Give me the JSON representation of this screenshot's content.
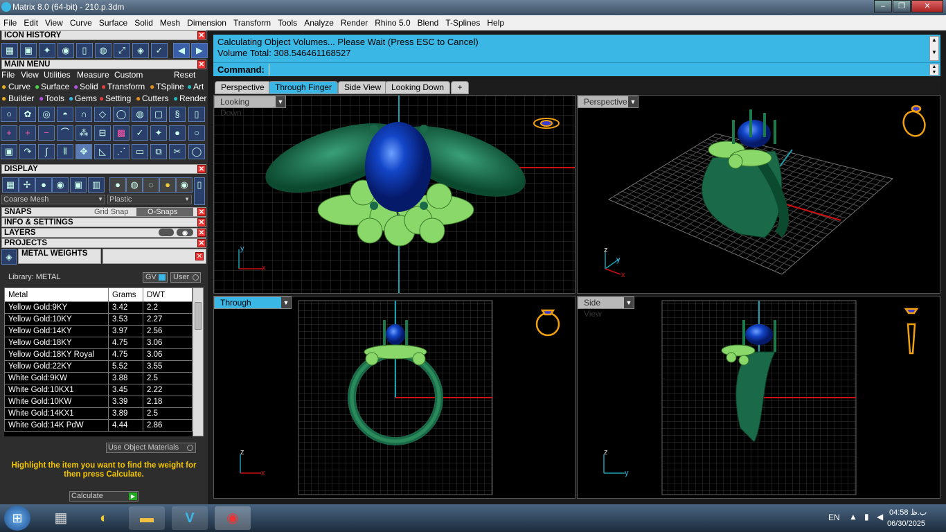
{
  "window": {
    "title": "Matrix 8.0 (64-bit) - 210.p.3dm",
    "min": "–",
    "max": "❐",
    "close": "✕"
  },
  "menu": [
    "File",
    "Edit",
    "View",
    "Curve",
    "Surface",
    "Solid",
    "Mesh",
    "Dimension",
    "Transform",
    "Tools",
    "Analyze",
    "Render",
    "Rhino 5.0",
    "Blend",
    "T-Splines",
    "Help"
  ],
  "left": {
    "icon_history": "ICON HISTORY",
    "main_menu": "MAIN MENU",
    "mm_items": [
      "File",
      "View",
      "Utilities",
      "Measure",
      "Custom"
    ],
    "reset": "Reset",
    "cat_row1": [
      "Curve",
      "Surface",
      "Solid",
      "Transform",
      "TSpline",
      "Art"
    ],
    "cat_row2": [
      "Builder",
      "Tools",
      "Gems",
      "Setting",
      "Cutters",
      "Render"
    ],
    "display": "DISPLAY",
    "coarse_mesh": "Coarse Mesh",
    "plastic": "Plastic",
    "snaps": "SNAPS",
    "grid_snap": "Grid Snap",
    "o_snaps": "O-Snaps",
    "info": "INFO & SETTINGS",
    "layers": "LAYERS",
    "projects": "PROJECTS",
    "metal_weights": "METAL WEIGHTS",
    "library": "Library: METAL",
    "gv": "GV",
    "user": "User",
    "table_headers": [
      "Metal",
      "Grams",
      "DWT"
    ],
    "rows": [
      [
        "Yellow Gold:9KY",
        "3.42",
        "2.2"
      ],
      [
        "Yellow Gold:10KY",
        "3.53",
        "2.27"
      ],
      [
        "Yellow Gold:14KY",
        "3.97",
        "2.56"
      ],
      [
        "Yellow Gold:18KY",
        "4.75",
        "3.06"
      ],
      [
        "Yellow Gold:18KY Royal",
        "4.75",
        "3.06"
      ],
      [
        "Yellow Gold:22KY",
        "5.52",
        "3.55"
      ],
      [
        "White Gold:9KW",
        "3.88",
        "2.5"
      ],
      [
        "White Gold:10KX1",
        "3.45",
        "2.22"
      ],
      [
        "White Gold:10KW",
        "3.39",
        "2.18"
      ],
      [
        "White Gold:14KX1",
        "3.89",
        "2.5"
      ],
      [
        "White Gold:14K PdW",
        "4.44",
        "2.86"
      ]
    ],
    "use_object_materials": "Use Object Materials",
    "hint": "Highlight the item you want to find the weight for then press Calculate.",
    "calculate": "Calculate"
  },
  "command": {
    "line1": "Calculating Object Volumes... Please Wait (Press ESC to Cancel)",
    "line2": "Volume Total: 308.546461168527",
    "prompt": "Command:"
  },
  "viewport_tabs": [
    "Perspective",
    "Through Finger",
    "Side View",
    "Looking Down"
  ],
  "add_tab": "+",
  "viewports": {
    "tl": "Looking Down",
    "tr": "Perspective",
    "bl": "Through Finger",
    "br": "Side View"
  },
  "axes": {
    "x": "x",
    "y": "y",
    "z": "z"
  },
  "tray": {
    "lang": "EN",
    "time": "04:58 ب.ظ",
    "date": "06/30/2025"
  },
  "colors": {
    "accent": "#3bb7e6",
    "ring_green": "#1f7a55",
    "leaf_green": "#8ad86a",
    "gem_blue": "#0a2f9a",
    "gold_icon": "#f0a010"
  }
}
